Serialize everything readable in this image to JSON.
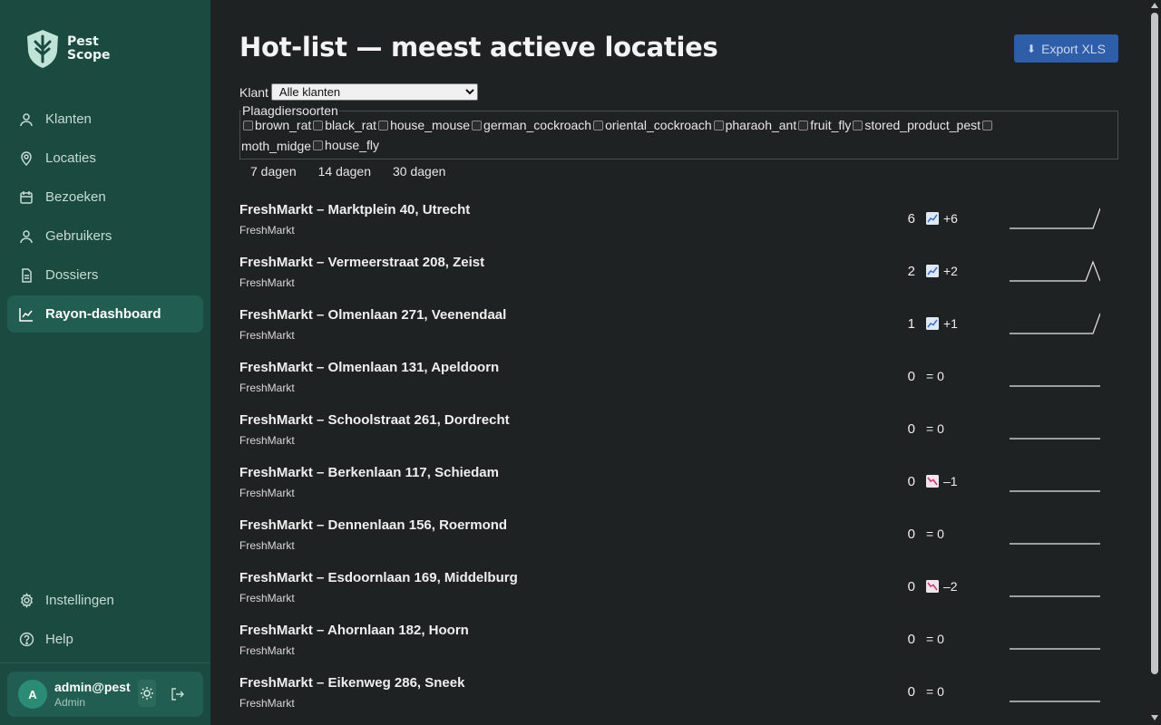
{
  "app": {
    "logo_line1": "Pest",
    "logo_line2": "Scope"
  },
  "sidebar": {
    "items": [
      {
        "label": "Klanten",
        "icon": "user-icon"
      },
      {
        "label": "Locaties",
        "icon": "map-pin-icon"
      },
      {
        "label": "Bezoeken",
        "icon": "calendar-icon"
      },
      {
        "label": "Gebruikers",
        "icon": "user-icon"
      },
      {
        "label": "Dossiers",
        "icon": "file-icon"
      },
      {
        "label": "Rayon-dashboard",
        "icon": "chart-line-icon",
        "active": true
      }
    ],
    "bottom_items": [
      {
        "label": "Instellingen",
        "icon": "gear-icon"
      },
      {
        "label": "Help",
        "icon": "help-circle-icon"
      }
    ],
    "user": {
      "initial": "A",
      "name": "admin@pest",
      "role": "Admin"
    }
  },
  "main": {
    "title": "Hot-list — meest actieve locaties",
    "export_label": "Export XLS",
    "klant_label": "Klant",
    "klant_selected": "Alle klanten",
    "species_legend": "Plaagdiersoorten",
    "species": [
      "brown_rat",
      "black_rat",
      "house_mouse",
      "german_cockroach",
      "oriental_cockroach",
      "pharaoh_ant",
      "fruit_fly",
      "stored_product_pest",
      "moth_midge",
      "house_fly"
    ],
    "periods": [
      "7 dagen",
      "14 dagen",
      "30 dagen"
    ]
  },
  "locations": [
    {
      "name": "FreshMarkt – Marktplein 40, Utrecht",
      "client": "FreshMarkt",
      "count": "6",
      "delta": "+6",
      "trend": "up",
      "spark": "rise"
    },
    {
      "name": "FreshMarkt – Vermeerstraat 208, Zeist",
      "client": "FreshMarkt",
      "count": "2",
      "delta": "+2",
      "trend": "up",
      "spark": "peak"
    },
    {
      "name": "FreshMarkt – Olmenlaan 271, Veenendaal",
      "client": "FreshMarkt",
      "count": "1",
      "delta": "+1",
      "trend": "up",
      "spark": "rise"
    },
    {
      "name": "FreshMarkt – Olmenlaan 131, Apeldoorn",
      "client": "FreshMarkt",
      "count": "0",
      "delta": "= 0",
      "trend": "flat",
      "spark": "flat"
    },
    {
      "name": "FreshMarkt – Schoolstraat 261, Dordrecht",
      "client": "FreshMarkt",
      "count": "0",
      "delta": "= 0",
      "trend": "flat",
      "spark": "flat"
    },
    {
      "name": "FreshMarkt – Berkenlaan 117, Schiedam",
      "client": "FreshMarkt",
      "count": "0",
      "delta": "–1",
      "trend": "down",
      "spark": "flat"
    },
    {
      "name": "FreshMarkt – Dennenlaan 156, Roermond",
      "client": "FreshMarkt",
      "count": "0",
      "delta": "= 0",
      "trend": "flat",
      "spark": "flat"
    },
    {
      "name": "FreshMarkt – Esdoornlaan 169, Middelburg",
      "client": "FreshMarkt",
      "count": "0",
      "delta": "–2",
      "trend": "down",
      "spark": "flat"
    },
    {
      "name": "FreshMarkt – Ahornlaan 182, Hoorn",
      "client": "FreshMarkt",
      "count": "0",
      "delta": "= 0",
      "trend": "flat",
      "spark": "flat"
    },
    {
      "name": "FreshMarkt – Eikenweg 286, Sneek",
      "client": "FreshMarkt",
      "count": "0",
      "delta": "= 0",
      "trend": "flat",
      "spark": "flat"
    }
  ],
  "colors": {
    "sidebar": "#1b4a40",
    "active": "#215e51",
    "accent": "#2f5ea8",
    "background": "#1f2222"
  }
}
